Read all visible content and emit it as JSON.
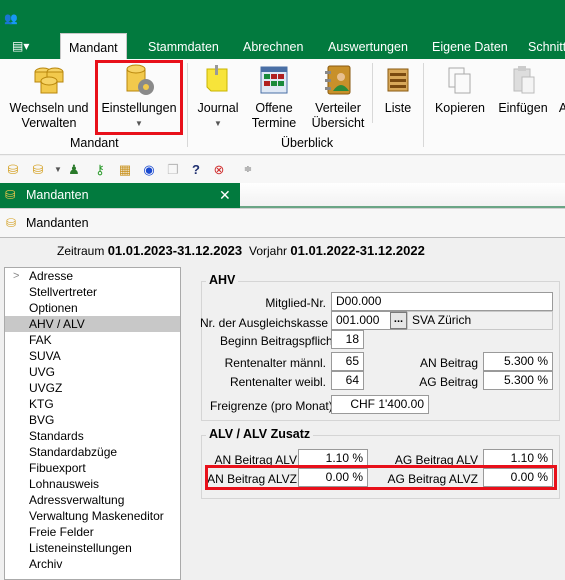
{
  "ribbon_tabs": [
    {
      "label": "Mandant",
      "active": true
    },
    {
      "label": "Stammdaten"
    },
    {
      "label": "Abrechnen"
    },
    {
      "label": "Auswertungen"
    },
    {
      "label": "Eigene Daten"
    },
    {
      "label": "Schnitt"
    }
  ],
  "ribbon": {
    "wechseln": "Wechseln und",
    "wechseln2": "Verwalten",
    "einstellungen": "Einstellungen",
    "journal": "Journal",
    "offene": "Offene",
    "termine": "Termine",
    "verteiler": "Verteiler",
    "uebersicht": "Übersicht",
    "liste": "Liste",
    "kopieren": "Kopieren",
    "einfuegen": "Einfügen",
    "more": "A",
    "group_mandant": "Mandant",
    "group_ueberblick": "Überblick"
  },
  "doc_tab": {
    "title": "Mandanten",
    "close": "✕"
  },
  "subheader": {
    "title": "Mandanten"
  },
  "period": {
    "zeitraum_label": "Zeitraum",
    "zeitraum_value": "01.01.2023-31.12.2023",
    "vorjahr_label": "Vorjahr",
    "vorjahr_value": "01.01.2022-31.12.2022"
  },
  "nav": [
    "Adresse",
    "Stellvertreter",
    "Optionen",
    "AHV / ALV",
    "FAK",
    "SUVA",
    "UVG",
    "UVGZ",
    "KTG",
    "BVG",
    "Standards",
    "Standardabzüge",
    "Fibuexport",
    "Lohnausweis",
    "Adressverwaltung",
    "Verwaltung Maskeneditor",
    "Freie Felder",
    "Listeneinstellungen",
    "Archiv"
  ],
  "nav_selected": "AHV / ALV",
  "ahv": {
    "title": "AHV",
    "mitglied_label": "Mitglied-Nr.",
    "mitglied_value": "D00.000",
    "kasse_label": "Nr. der Ausgleichskasse",
    "kasse_value": "001.000",
    "kasse_button": "...",
    "kasse_name": "SVA Zürich",
    "beginn_label": "Beginn Beitragspflicht",
    "beginn_value": "18",
    "rm_label": "Rentenalter männl.",
    "rm_value": "65",
    "rw_label": "Rentenalter weibl.",
    "rw_value": "64",
    "an_label": "AN Beitrag",
    "an_value": "5.300 %",
    "ag_label": "AG Beitrag",
    "ag_value": "5.300 %",
    "frei_label": "Freigrenze (pro Monat)",
    "frei_value": "CHF 1'400.00"
  },
  "alv": {
    "title": "ALV / ALV Zusatz",
    "an_alv_label": "AN Beitrag ALV",
    "an_alv_value": "1.10 %",
    "ag_alv_label": "AG Beitrag ALV",
    "ag_alv_value": "1.10 %",
    "an_alvz_label": "AN Beitrag ALVZ",
    "an_alvz_value": "0.00 %",
    "ag_alvz_label": "AG Beitrag ALVZ",
    "ag_alvz_value": "0.00 %"
  }
}
